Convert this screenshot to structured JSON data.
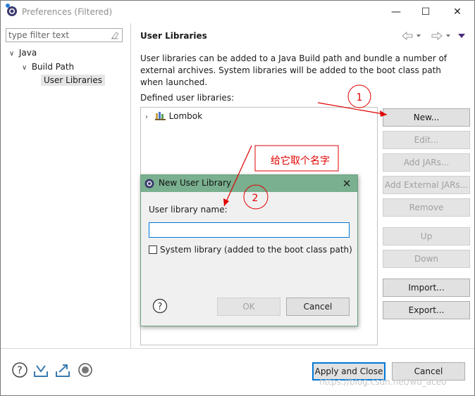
{
  "window": {
    "title": "Preferences (Filtered)",
    "min_label": "—",
    "max_label": "☐",
    "close_label": "✕"
  },
  "sidebar": {
    "filter_placeholder": "type filter text",
    "tree": [
      {
        "label": "Java",
        "chevron": "∨"
      },
      {
        "label": "Build Path",
        "chevron": "∨"
      },
      {
        "label": "User Libraries",
        "chevron": ""
      }
    ]
  },
  "main": {
    "title": "User Libraries",
    "description": "User libraries can be added to a Java Build path and bundle a number of external archives. System libraries will be added to the boot class path when launched.",
    "defined_label": "Defined user libraries:",
    "libraries": [
      {
        "name": "Lombok",
        "chevron": "›"
      }
    ],
    "buttons": {
      "new": "New...",
      "edit": "Edit...",
      "add_jars": "Add JARs...",
      "add_external_jars": "Add External JARs...",
      "remove": "Remove",
      "up": "Up",
      "down": "Down",
      "import": "Import...",
      "export": "Export..."
    }
  },
  "footer": {
    "apply_close": "Apply and Close",
    "cancel": "Cancel"
  },
  "dialog": {
    "title": "New User Library",
    "close_label": "✕",
    "name_label": "User library name:",
    "name_value": "",
    "system_checkbox_label": "System library (added to the boot class path)",
    "system_checked": false,
    "ok": "OK",
    "cancel": "Cancel"
  },
  "annotations": {
    "circle1": "1",
    "circle2": "2",
    "note": "给它取个名字"
  },
  "watermark": "https://blog.csdn.net/wu_aceo",
  "colors": {
    "dialog_title_bg": "#7ab08f",
    "annotation_red": "#e00000",
    "focus_blue": "#0078d7"
  }
}
